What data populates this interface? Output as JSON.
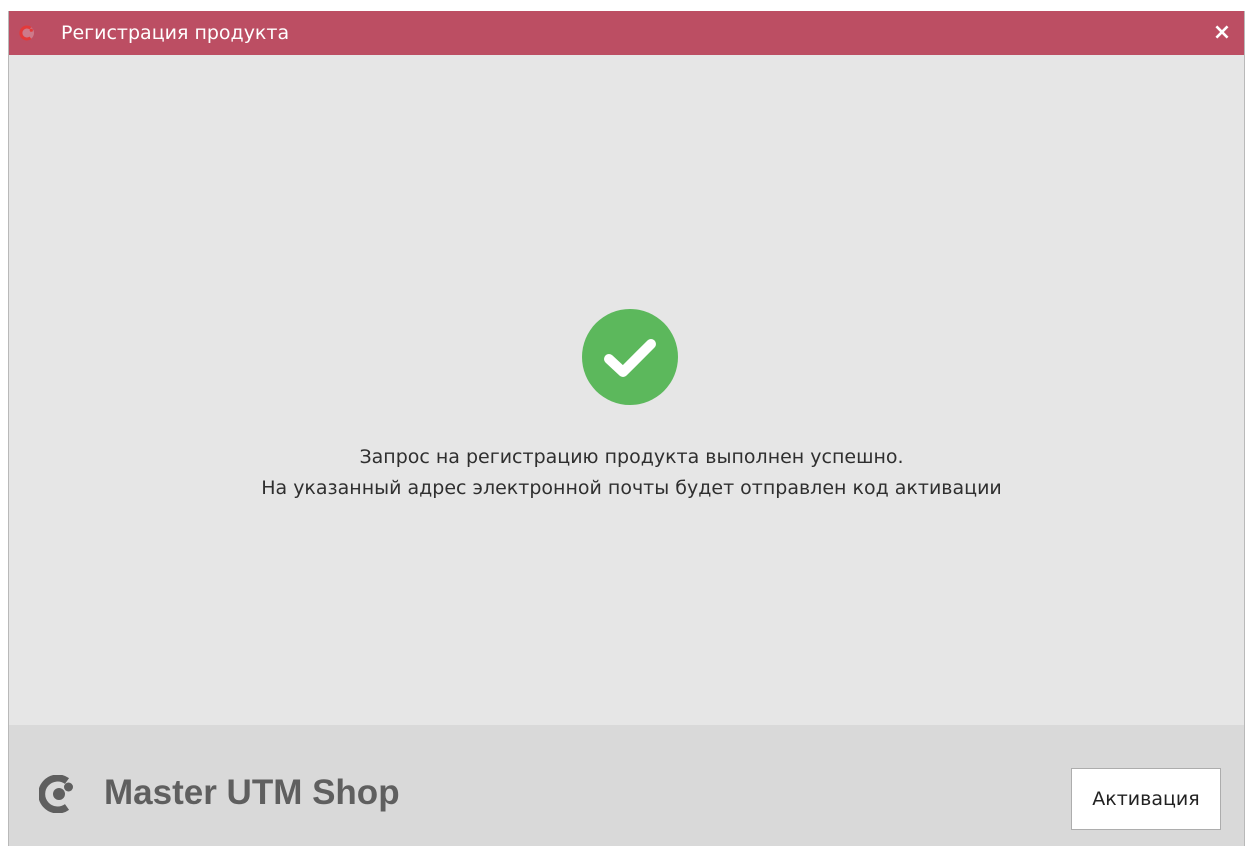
{
  "window": {
    "title": "Регистрация продукта",
    "close_label": "×",
    "title_bar_color": "#bc4e63"
  },
  "icons": {
    "app": "app-logo-icon",
    "close": "close-icon",
    "success": "success-check-icon",
    "brand": "brand-logo-icon"
  },
  "status": {
    "success_color": "#5cb85c",
    "message_line_1": "Запрос на регистрацию продукта выполнен успешно.",
    "message_line_2": "На указанный адрес электронной почты  будет отправлен код активации"
  },
  "footer": {
    "brand_name": "Master UTM Shop",
    "activate_label": "Активация"
  }
}
